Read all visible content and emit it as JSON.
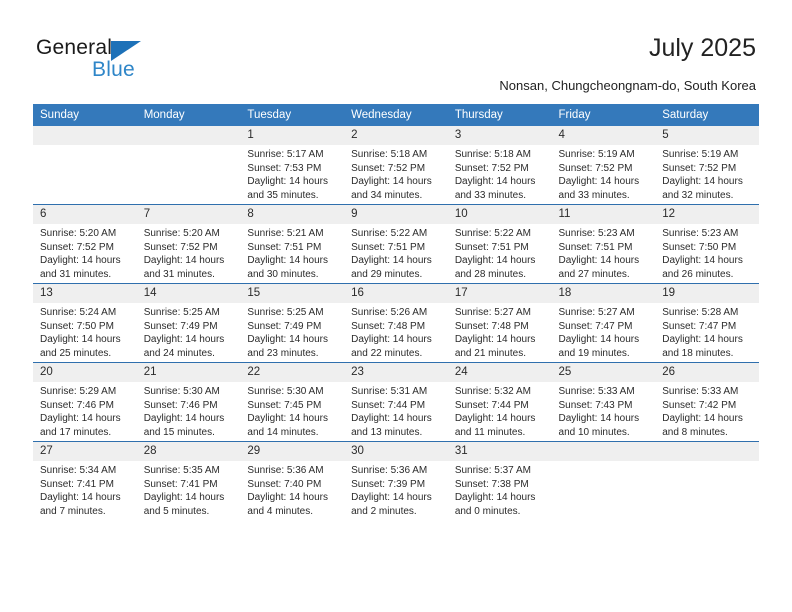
{
  "brand": {
    "name_top": "General",
    "name_bottom": "Blue",
    "accent_color": "#1d71b8",
    "blue_text_color": "#2f86c8"
  },
  "header": {
    "title": "July 2025",
    "subtitle": "Nonsan, Chungcheongnam-do, South Korea"
  },
  "theme": {
    "header_row_bg": "#3479bb",
    "row_divider": "#2f6fad",
    "daynum_bg": "#efefef",
    "text": "#2b2b2b"
  },
  "weekdays": [
    "Sunday",
    "Monday",
    "Tuesday",
    "Wednesday",
    "Thursday",
    "Friday",
    "Saturday"
  ],
  "weeks": [
    [
      {
        "day": "",
        "empty": true
      },
      {
        "day": "",
        "empty": true
      },
      {
        "day": "1",
        "sunrise": "Sunrise: 5:17 AM",
        "sunset": "Sunset: 7:53 PM",
        "daylight": "Daylight: 14 hours and 35 minutes."
      },
      {
        "day": "2",
        "sunrise": "Sunrise: 5:18 AM",
        "sunset": "Sunset: 7:52 PM",
        "daylight": "Daylight: 14 hours and 34 minutes."
      },
      {
        "day": "3",
        "sunrise": "Sunrise: 5:18 AM",
        "sunset": "Sunset: 7:52 PM",
        "daylight": "Daylight: 14 hours and 33 minutes."
      },
      {
        "day": "4",
        "sunrise": "Sunrise: 5:19 AM",
        "sunset": "Sunset: 7:52 PM",
        "daylight": "Daylight: 14 hours and 33 minutes."
      },
      {
        "day": "5",
        "sunrise": "Sunrise: 5:19 AM",
        "sunset": "Sunset: 7:52 PM",
        "daylight": "Daylight: 14 hours and 32 minutes."
      }
    ],
    [
      {
        "day": "6",
        "sunrise": "Sunrise: 5:20 AM",
        "sunset": "Sunset: 7:52 PM",
        "daylight": "Daylight: 14 hours and 31 minutes."
      },
      {
        "day": "7",
        "sunrise": "Sunrise: 5:20 AM",
        "sunset": "Sunset: 7:52 PM",
        "daylight": "Daylight: 14 hours and 31 minutes."
      },
      {
        "day": "8",
        "sunrise": "Sunrise: 5:21 AM",
        "sunset": "Sunset: 7:51 PM",
        "daylight": "Daylight: 14 hours and 30 minutes."
      },
      {
        "day": "9",
        "sunrise": "Sunrise: 5:22 AM",
        "sunset": "Sunset: 7:51 PM",
        "daylight": "Daylight: 14 hours and 29 minutes."
      },
      {
        "day": "10",
        "sunrise": "Sunrise: 5:22 AM",
        "sunset": "Sunset: 7:51 PM",
        "daylight": "Daylight: 14 hours and 28 minutes."
      },
      {
        "day": "11",
        "sunrise": "Sunrise: 5:23 AM",
        "sunset": "Sunset: 7:51 PM",
        "daylight": "Daylight: 14 hours and 27 minutes."
      },
      {
        "day": "12",
        "sunrise": "Sunrise: 5:23 AM",
        "sunset": "Sunset: 7:50 PM",
        "daylight": "Daylight: 14 hours and 26 minutes."
      }
    ],
    [
      {
        "day": "13",
        "sunrise": "Sunrise: 5:24 AM",
        "sunset": "Sunset: 7:50 PM",
        "daylight": "Daylight: 14 hours and 25 minutes."
      },
      {
        "day": "14",
        "sunrise": "Sunrise: 5:25 AM",
        "sunset": "Sunset: 7:49 PM",
        "daylight": "Daylight: 14 hours and 24 minutes."
      },
      {
        "day": "15",
        "sunrise": "Sunrise: 5:25 AM",
        "sunset": "Sunset: 7:49 PM",
        "daylight": "Daylight: 14 hours and 23 minutes."
      },
      {
        "day": "16",
        "sunrise": "Sunrise: 5:26 AM",
        "sunset": "Sunset: 7:48 PM",
        "daylight": "Daylight: 14 hours and 22 minutes."
      },
      {
        "day": "17",
        "sunrise": "Sunrise: 5:27 AM",
        "sunset": "Sunset: 7:48 PM",
        "daylight": "Daylight: 14 hours and 21 minutes."
      },
      {
        "day": "18",
        "sunrise": "Sunrise: 5:27 AM",
        "sunset": "Sunset: 7:47 PM",
        "daylight": "Daylight: 14 hours and 19 minutes."
      },
      {
        "day": "19",
        "sunrise": "Sunrise: 5:28 AM",
        "sunset": "Sunset: 7:47 PM",
        "daylight": "Daylight: 14 hours and 18 minutes."
      }
    ],
    [
      {
        "day": "20",
        "sunrise": "Sunrise: 5:29 AM",
        "sunset": "Sunset: 7:46 PM",
        "daylight": "Daylight: 14 hours and 17 minutes."
      },
      {
        "day": "21",
        "sunrise": "Sunrise: 5:30 AM",
        "sunset": "Sunset: 7:46 PM",
        "daylight": "Daylight: 14 hours and 15 minutes."
      },
      {
        "day": "22",
        "sunrise": "Sunrise: 5:30 AM",
        "sunset": "Sunset: 7:45 PM",
        "daylight": "Daylight: 14 hours and 14 minutes."
      },
      {
        "day": "23",
        "sunrise": "Sunrise: 5:31 AM",
        "sunset": "Sunset: 7:44 PM",
        "daylight": "Daylight: 14 hours and 13 minutes."
      },
      {
        "day": "24",
        "sunrise": "Sunrise: 5:32 AM",
        "sunset": "Sunset: 7:44 PM",
        "daylight": "Daylight: 14 hours and 11 minutes."
      },
      {
        "day": "25",
        "sunrise": "Sunrise: 5:33 AM",
        "sunset": "Sunset: 7:43 PM",
        "daylight": "Daylight: 14 hours and 10 minutes."
      },
      {
        "day": "26",
        "sunrise": "Sunrise: 5:33 AM",
        "sunset": "Sunset: 7:42 PM",
        "daylight": "Daylight: 14 hours and 8 minutes."
      }
    ],
    [
      {
        "day": "27",
        "sunrise": "Sunrise: 5:34 AM",
        "sunset": "Sunset: 7:41 PM",
        "daylight": "Daylight: 14 hours and 7 minutes."
      },
      {
        "day": "28",
        "sunrise": "Sunrise: 5:35 AM",
        "sunset": "Sunset: 7:41 PM",
        "daylight": "Daylight: 14 hours and 5 minutes."
      },
      {
        "day": "29",
        "sunrise": "Sunrise: 5:36 AM",
        "sunset": "Sunset: 7:40 PM",
        "daylight": "Daylight: 14 hours and 4 minutes."
      },
      {
        "day": "30",
        "sunrise": "Sunrise: 5:36 AM",
        "sunset": "Sunset: 7:39 PM",
        "daylight": "Daylight: 14 hours and 2 minutes."
      },
      {
        "day": "31",
        "sunrise": "Sunrise: 5:37 AM",
        "sunset": "Sunset: 7:38 PM",
        "daylight": "Daylight: 14 hours and 0 minutes."
      },
      {
        "day": "",
        "empty": true
      },
      {
        "day": "",
        "empty": true
      }
    ]
  ]
}
